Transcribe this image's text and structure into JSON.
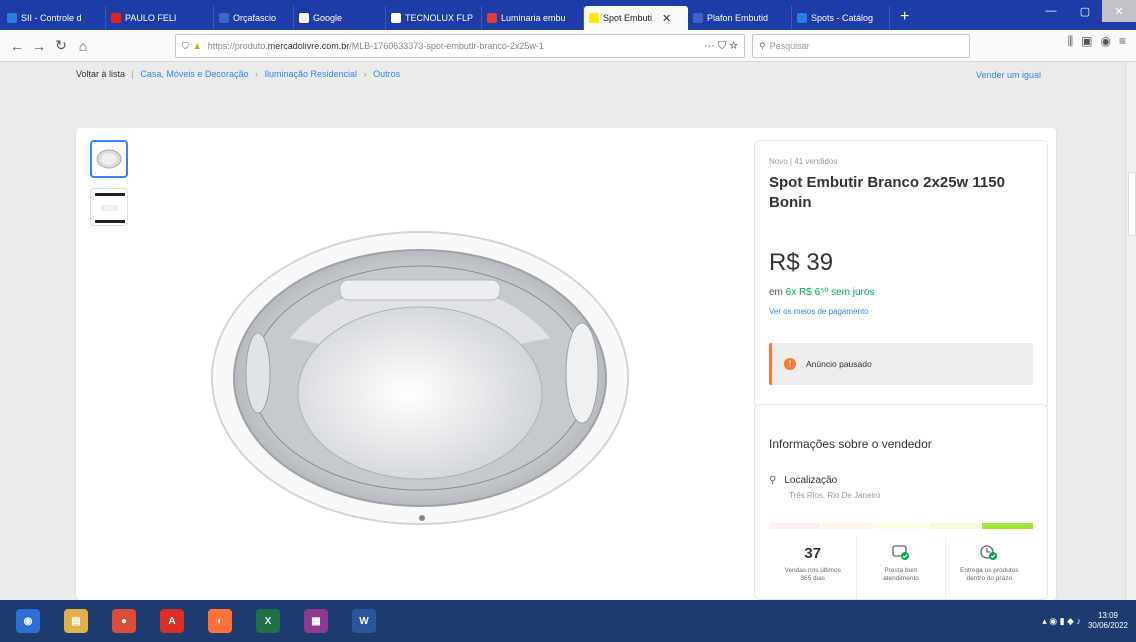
{
  "browser": {
    "tabs": [
      {
        "title": "SII - Controle d",
        "color": "#2a7de1",
        "active": false
      },
      {
        "title": "PAULO FELI",
        "color": "#e62117",
        "active": false
      },
      {
        "title": "Orçafascio",
        "color": "#3a66c4",
        "active": false
      },
      {
        "title": "Google",
        "color": "#ffffff",
        "active": false
      },
      {
        "title": "TECNOLUX FLP",
        "color": "#ffffff",
        "active": false
      },
      {
        "title": "Luminaria embu",
        "color": "#e53935",
        "active": false
      },
      {
        "title": "Spot Embuti",
        "color": "#ffe600",
        "active": true
      },
      {
        "title": "Plafon Embutid",
        "color": "#3a66c4",
        "active": false
      },
      {
        "title": "Spots - Catálog",
        "color": "#2a7de1",
        "active": false
      }
    ],
    "url_prefix": "https://produto.",
    "url_domain": "mercadolivre.com.br",
    "url_rest": "/MLB-1760633373-spot-embutir-branco-2x25w-1",
    "search_placeholder": "Pesquisar"
  },
  "page": {
    "breadcrumb": {
      "back": "Voltar à lista",
      "items": [
        "Casa, Móveis e Decoração",
        "Iluminação Residencial",
        "Outros"
      ]
    },
    "sell_same": "Vender um igual",
    "product": {
      "condition": "Novo  |  41 vendidos",
      "title": "Spot Embutir Branco 2x25w 1150 Bonin",
      "price": "R$ 39",
      "installments_prefix": "em ",
      "installments": "6x R$ 6⁵⁰ sem juros",
      "payment_link": "Ver os meios de pagamento",
      "paused_notice": "Anúncio pausado"
    },
    "seller": {
      "title": "Informações sobre o vendedor",
      "location_label": "Localização",
      "location_value": "Três Rios, Rio De Janeiro",
      "reputation_colors": [
        "#fff0f0",
        "#fff5e6",
        "#fffce6",
        "#f1fdd7",
        "#a3e635"
      ],
      "stats": [
        {
          "value": "37",
          "label": "Vendas nos últimos 365 dias",
          "icon": "sales-count"
        },
        {
          "value": "",
          "label": "Presta bom atendimento",
          "icon": "chat-check-icon"
        },
        {
          "value": "",
          "label": "Entrega os produtos dentro do prazo",
          "icon": "clock-check-icon"
        }
      ]
    }
  },
  "taskbar": {
    "apps": [
      {
        "name": "start-orb",
        "color": "#2f6fd4",
        "glyph": "◉"
      },
      {
        "name": "explorer",
        "color": "#e2b24a",
        "glyph": "▤"
      },
      {
        "name": "chrome",
        "color": "#dd4b39",
        "glyph": "●"
      },
      {
        "name": "acrobat",
        "color": "#d93025",
        "glyph": "A"
      },
      {
        "name": "firefox",
        "color": "#ff7139",
        "glyph": "◐"
      },
      {
        "name": "excel",
        "color": "#1d7145",
        "glyph": "X"
      },
      {
        "name": "winrar",
        "color": "#8e3a8e",
        "glyph": "▦"
      },
      {
        "name": "word",
        "color": "#2b579a",
        "glyph": "W"
      }
    ],
    "time": "13:09",
    "date": "30/06/2022"
  }
}
